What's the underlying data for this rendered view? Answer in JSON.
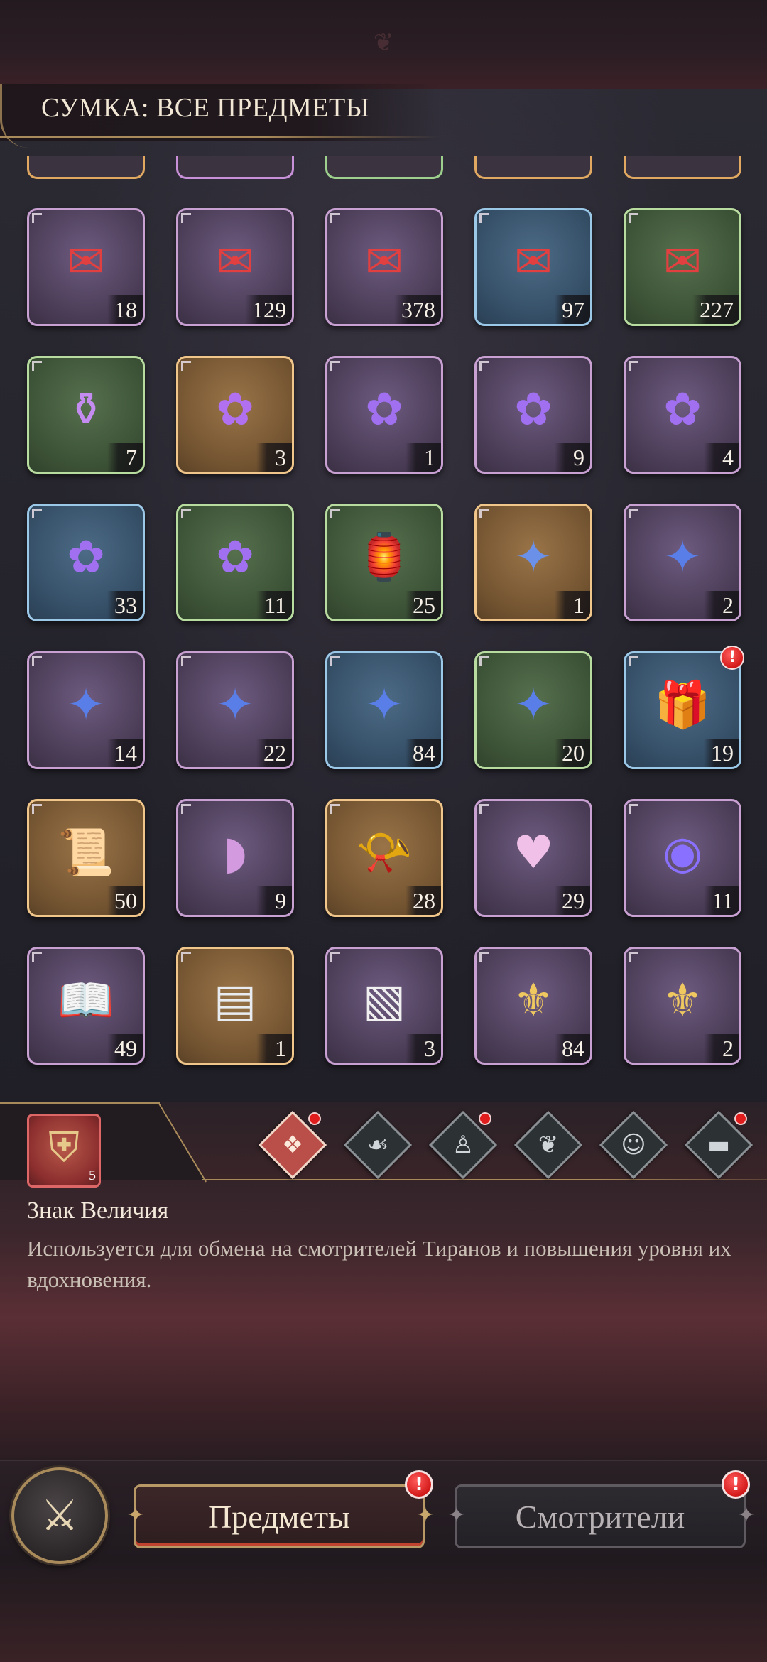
{
  "header": {
    "title": "СУМКА: ВСЕ ПРЕДМЕТЫ"
  },
  "partial_row": {
    "colors": [
      "#e0a860",
      "#c890d8",
      "#9cd08c",
      "#e0a860",
      "#e0a860"
    ]
  },
  "grid": {
    "rows": [
      [
        {
          "icon": "red-envelope-blood-icon",
          "glyph": "✉",
          "glyph_color": "#e24040",
          "rarity": "purple",
          "count": "18"
        },
        {
          "icon": "red-envelopes-stack-icon",
          "glyph": "✉",
          "glyph_color": "#e24040",
          "rarity": "purple",
          "count": "129"
        },
        {
          "icon": "red-envelopes-bundle-icon",
          "glyph": "✉",
          "glyph_color": "#e24040",
          "rarity": "purple",
          "count": "378"
        },
        {
          "icon": "red-envelopes-pair-icon",
          "glyph": "✉",
          "glyph_color": "#e24040",
          "rarity": "blue",
          "count": "97"
        },
        {
          "icon": "red-envelope-single-icon",
          "glyph": "✉",
          "glyph_color": "#e24040",
          "rarity": "green",
          "count": "227"
        }
      ],
      [
        {
          "icon": "flower-jar-icon",
          "glyph": "⚱",
          "glyph_color": "#c48cf0",
          "rarity": "green",
          "count": "7"
        },
        {
          "icon": "black-ticket-flower-icon",
          "glyph": "✿",
          "glyph_color": "#b070f0",
          "rarity": "gold",
          "count": "3"
        },
        {
          "icon": "purple-ticket-flower-icon",
          "glyph": "✿",
          "glyph_color": "#a070f0",
          "rarity": "purple",
          "count": "1"
        },
        {
          "icon": "purple-tickets-flower-icon",
          "glyph": "✿",
          "glyph_color": "#a070f0",
          "rarity": "purple",
          "count": "9"
        },
        {
          "icon": "purple-tickets-bundle-icon",
          "glyph": "✿",
          "glyph_color": "#a070f0",
          "rarity": "purple",
          "count": "4"
        }
      ],
      [
        {
          "icon": "purple-ticket-pair-icon",
          "glyph": "✿",
          "glyph_color": "#a070f0",
          "rarity": "blue",
          "count": "33"
        },
        {
          "icon": "purple-ticket-single-icon",
          "glyph": "✿",
          "glyph_color": "#a070f0",
          "rarity": "green",
          "count": "11"
        },
        {
          "icon": "lantern-icon",
          "glyph": "🏮",
          "glyph_color": "#e0e0e0",
          "rarity": "green",
          "count": "25"
        },
        {
          "icon": "black-ticket-bat-icon",
          "glyph": "✦",
          "glyph_color": "#6a90e8",
          "rarity": "gold",
          "count": "1"
        },
        {
          "icon": "blue-ticket-bat-icon",
          "glyph": "✦",
          "glyph_color": "#5a7ee8",
          "rarity": "purple",
          "count": "2"
        }
      ],
      [
        {
          "icon": "blue-tickets-bat-icon",
          "glyph": "✦",
          "glyph_color": "#5a7ee8",
          "rarity": "purple",
          "count": "14"
        },
        {
          "icon": "blue-tickets-stack-bat-icon",
          "glyph": "✦",
          "glyph_color": "#5a7ee8",
          "rarity": "purple",
          "count": "22"
        },
        {
          "icon": "blue-tickets-pair-bat-icon",
          "glyph": "✦",
          "glyph_color": "#5a7ee8",
          "rarity": "blue",
          "count": "84"
        },
        {
          "icon": "blue-ticket-single-bat-icon",
          "glyph": "✦",
          "glyph_color": "#5a7ee8",
          "rarity": "green",
          "count": "20"
        },
        {
          "icon": "gift-box-icon",
          "glyph": "🎁",
          "glyph_color": "#e0d0d0",
          "rarity": "blue",
          "count": "19",
          "badge": "!"
        }
      ],
      [
        {
          "icon": "scrolls-icon",
          "glyph": "📜",
          "glyph_color": "#e8c878",
          "rarity": "gold",
          "count": "50"
        },
        {
          "icon": "silk-cloth-icon",
          "glyph": "◗",
          "glyph_color": "#d49ae0",
          "rarity": "purple",
          "count": "9"
        },
        {
          "icon": "gold-horn-icon",
          "glyph": "📯",
          "glyph_color": "#e8c050",
          "rarity": "gold",
          "count": "28"
        },
        {
          "icon": "heart-frame-icon",
          "glyph": "♥",
          "glyph_color": "#f0c0e8",
          "rarity": "purple",
          "count": "29"
        },
        {
          "icon": "hand-mirror-icon",
          "glyph": "◉",
          "glyph_color": "#8a70ff",
          "rarity": "purple",
          "count": "11"
        }
      ],
      [
        {
          "icon": "open-book-icon",
          "glyph": "📖",
          "glyph_color": "#d8b890",
          "rarity": "purple",
          "count": "49"
        },
        {
          "icon": "certificate-icon",
          "glyph": "▤",
          "glyph_color": "#e8ecf0",
          "rarity": "gold",
          "count": "1"
        },
        {
          "icon": "torn-paper-icon",
          "glyph": "▧",
          "glyph_color": "#f0f0f0",
          "rarity": "purple",
          "count": "3"
        },
        {
          "icon": "purple-banner-icon",
          "glyph": "⚜",
          "glyph_color": "#f0c860",
          "rarity": "purple",
          "count": "84"
        },
        {
          "icon": "torn-banner-icon",
          "glyph": "⚜",
          "glyph_color": "#f0c860",
          "rarity": "purple",
          "count": "2"
        }
      ]
    ]
  },
  "selected": {
    "icon": "crest-emblem-icon",
    "glyph": "⛨",
    "count": "5",
    "name": "Знак Величия",
    "description": "Используется для обмена на смотрителей Тиранов и повышения уровня их вдохновения."
  },
  "filters": [
    {
      "name": "filter-all",
      "icon": "grid-diamond-icon",
      "glyph": "❖",
      "active": true,
      "dot": true
    },
    {
      "name": "filter-consumables",
      "icon": "drops-bat-icon",
      "glyph": "☙",
      "active": false,
      "dot": false
    },
    {
      "name": "filter-keepers",
      "icon": "hooded-figure-icon",
      "glyph": "♙",
      "active": false,
      "dot": true
    },
    {
      "name": "filter-relations",
      "icon": "hearts-icon",
      "glyph": "❦",
      "active": false,
      "dot": false
    },
    {
      "name": "filter-pets",
      "icon": "cat-face-icon",
      "glyph": "☺",
      "active": false,
      "dot": false
    },
    {
      "name": "filter-chests",
      "icon": "treasure-chest-icon",
      "glyph": "▬",
      "active": false,
      "dot": true
    }
  ],
  "nav": {
    "home_glyph": "⚔",
    "tab_items": "Предметы",
    "tab_keepers": "Смотрители",
    "badge": "!"
  }
}
